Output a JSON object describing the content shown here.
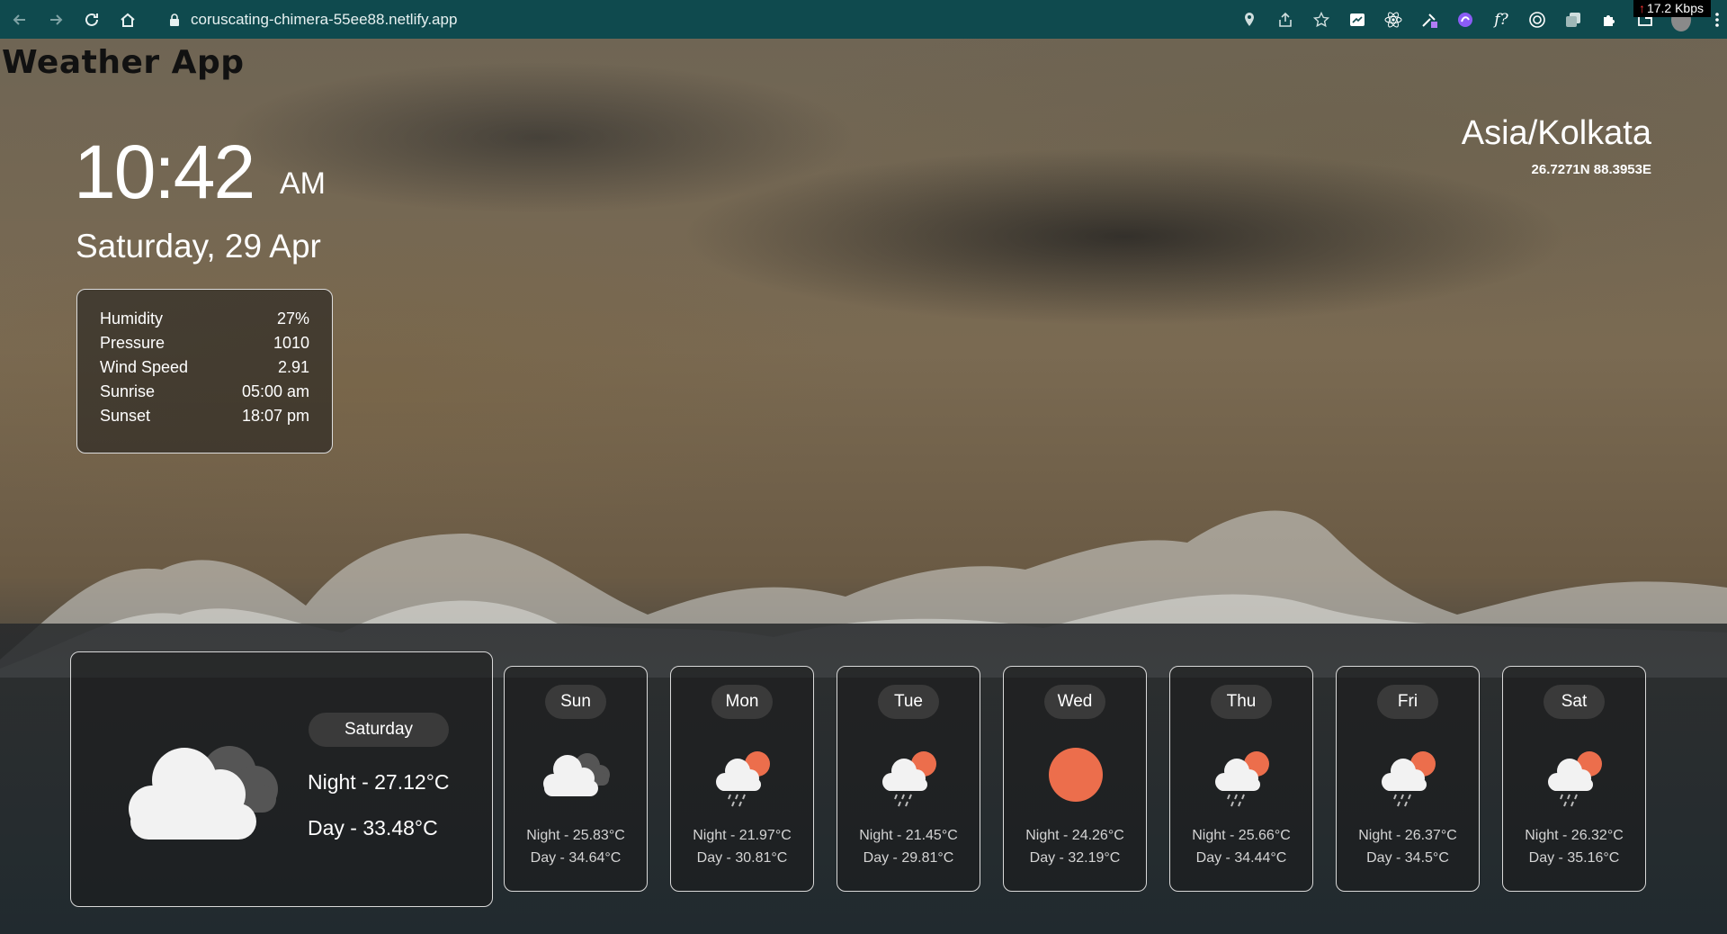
{
  "browser": {
    "url": "coruscating-chimera-55ee88.netlify.app",
    "speed": "17.2 Kbps",
    "extension_icons": [
      "location-icon",
      "share-icon",
      "star-icon",
      "screen-icon",
      "react-icon",
      "dropper-icon",
      "puzzle-circle-icon",
      "fx-icon",
      "target-icon",
      "copy-icon",
      "extensions-icon",
      "tab-icon",
      "avatar-icon",
      "menu-icon"
    ]
  },
  "app": {
    "title": "Weather App"
  },
  "time": {
    "clock": "10:42",
    "ampm": "AM",
    "date": "Saturday, 29 Apr"
  },
  "details": [
    {
      "label": "Humidity",
      "value": "27%"
    },
    {
      "label": "Pressure",
      "value": "1010"
    },
    {
      "label": "Wind Speed",
      "value": "2.91"
    },
    {
      "label": "Sunrise",
      "value": "05:00 am"
    },
    {
      "label": "Sunset",
      "value": "18:07 pm"
    }
  ],
  "location": {
    "timezone": "Asia/Kolkata",
    "coords": "26.7271N 88.3953E"
  },
  "today": {
    "day": "Saturday",
    "night": "Night - 27.12°C",
    "dayTemp": "Day - 33.48°C",
    "icon": "cloud-icon"
  },
  "forecast": [
    {
      "day": "Sun",
      "night": "Night - 25.83°C",
      "dayTemp": "Day - 34.64°C",
      "icon": "clouds-icon"
    },
    {
      "day": "Mon",
      "night": "Night - 21.97°C",
      "dayTemp": "Day - 30.81°C",
      "icon": "sun-rain-icon"
    },
    {
      "day": "Tue",
      "night": "Night - 21.45°C",
      "dayTemp": "Day - 29.81°C",
      "icon": "sun-rain-icon"
    },
    {
      "day": "Wed",
      "night": "Night - 24.26°C",
      "dayTemp": "Day - 32.19°C",
      "icon": "sun-icon"
    },
    {
      "day": "Thu",
      "night": "Night - 25.66°C",
      "dayTemp": "Day - 34.44°C",
      "icon": "sun-rain-icon"
    },
    {
      "day": "Fri",
      "night": "Night - 26.37°C",
      "dayTemp": "Day - 34.5°C",
      "icon": "sun-rain-icon"
    },
    {
      "day": "Sat",
      "night": "Night - 26.32°C",
      "dayTemp": "Day - 35.16°C",
      "icon": "sun-rain-icon"
    }
  ],
  "colors": {
    "chrome": "#0f4a4e",
    "sun": "#ec6e4c",
    "card_border": "#d9d9d9"
  }
}
